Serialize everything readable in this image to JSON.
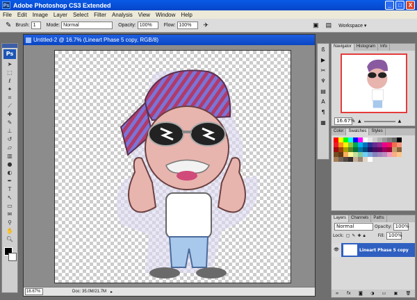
{
  "window": {
    "title": "Adobe Photoshop CS3 Extended",
    "logo": "Ps",
    "minimize": "_",
    "maximize": "□",
    "close": "X"
  },
  "menu": [
    "File",
    "Edit",
    "Image",
    "Layer",
    "Select",
    "Filter",
    "Analysis",
    "View",
    "Window",
    "Help"
  ],
  "options": {
    "brush_label": "Brush:",
    "brush_size": "1",
    "mode_label": "Mode:",
    "mode_value": "Normal",
    "opacity_label": "Opacity:",
    "opacity_value": "100%",
    "flow_label": "Flow:",
    "flow_value": "100%",
    "workspace": "Workspace ▾"
  },
  "toolbox": {
    "logo": "Ps",
    "tools": [
      "move-icon",
      "marquee-icon",
      "lasso-icon",
      "magic-wand-icon",
      "crop-icon",
      "slice-icon",
      "healing-icon",
      "brush-icon",
      "stamp-icon",
      "history-brush-icon",
      "eraser-icon",
      "gradient-icon",
      "blur-icon",
      "dodge-icon",
      "pen-icon",
      "type-icon",
      "path-select-icon",
      "shape-icon",
      "notes-icon",
      "eyedropper-icon",
      "hand-icon",
      "zoom-icon"
    ]
  },
  "document": {
    "title": "Untitled-2 @ 16.7% (Lineart Phase 5 copy, RGB/8)",
    "zoom": "16.67%",
    "doc_info": "Doc: 35.0M/21.7M"
  },
  "navigator": {
    "tabs": [
      "Navigator",
      "Histogram",
      "Info"
    ],
    "zoom": "16.67%"
  },
  "swatches": {
    "tabs": [
      "Color",
      "Swatches",
      "Styles"
    ]
  },
  "layers": {
    "tabs": [
      "Layers",
      "Channels",
      "Paths"
    ],
    "blend_mode": "Normal",
    "opacity_label": "Opacity:",
    "opacity_value": "100%",
    "lock_label": "Lock:",
    "fill_label": "Fill:",
    "fill_value": "100%",
    "layer_name": "Lineart Phase 5 copy"
  },
  "colors": {
    "swatches": [
      "#ff0000",
      "#ffff00",
      "#00ff00",
      "#00ffff",
      "#0000ff",
      "#ff00ff",
      "#ffffff",
      "#e6e6e6",
      "#cccccc",
      "#b3b3b3",
      "#999999",
      "#808080",
      "#666666",
      "#000000",
      "#ed1c24",
      "#f7941d",
      "#fff200",
      "#8dc63f",
      "#00a651",
      "#00aeef",
      "#0072bc",
      "#2e3192",
      "#662d91",
      "#92278f",
      "#ec008c",
      "#ed145b",
      "#f26c4f",
      "#f69679",
      "#9e0b0f",
      "#a0410d",
      "#aba000",
      "#598527",
      "#007236",
      "#0076a3",
      "#004a80",
      "#1b1464",
      "#440e62",
      "#630460",
      "#9e005d",
      "#9e0039",
      "#c69c6d",
      "#8c6239",
      "#754c24",
      "#603913",
      "#fbaf5d",
      "#fff799",
      "#c4df9b",
      "#82ca9c",
      "#6dcff6",
      "#7da7d9",
      "#8781bd",
      "#a186be",
      "#bd8cbf",
      "#f49ac1",
      "#f9ad81",
      "#fdc68a",
      "#a67c52",
      "#736357",
      "#534741",
      "#362f2d",
      "#c7b299",
      "#998675",
      "#e1d6c6",
      "#ffffff"
    ]
  }
}
